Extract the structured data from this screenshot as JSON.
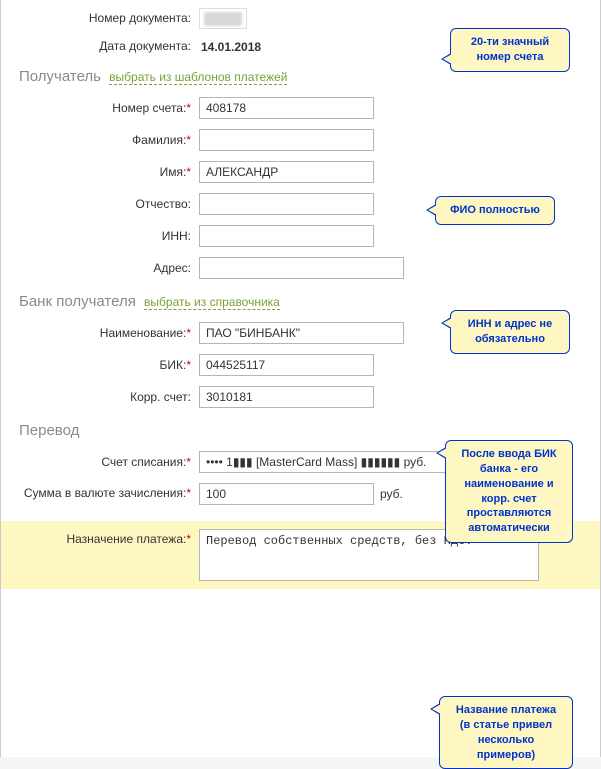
{
  "doc_no_label": "Номер документа:",
  "doc_no_value": "",
  "doc_date_label": "Дата документа:",
  "doc_date_value": "14.01.2018",
  "recipient": {
    "section": "Получатель",
    "templates_link": "выбрать из шаблонов платежей",
    "account_label": "Номер счета:",
    "account_value": "408178",
    "surname_label": "Фамилия:",
    "surname_value": "",
    "name_label": "Имя:",
    "name_value": "АЛЕКСАНДР",
    "patronymic_label": "Отчество:",
    "patronymic_value": "",
    "inn_label": "ИНН:",
    "inn_value": "",
    "address_label": "Адрес:",
    "address_value": ""
  },
  "bank": {
    "section": "Банк получателя",
    "dir_link": "выбрать из справочника",
    "name_label": "Наименование:",
    "name_value": "ПАО \"БИНБАНК\"",
    "bik_label": "БИК:",
    "bik_value": "044525117",
    "corr_label": "Корр. счет:",
    "corr_value": "3010181"
  },
  "transfer": {
    "section": "Перевод",
    "writeoff_label": "Счет списания:",
    "writeoff_value": "•••• 1▮▮▮ [MasterCard Mass]  ▮▮▮▮▮▮ руб.",
    "amount_label": "Сумма в валюте зачисления:",
    "amount_value": "100",
    "amount_unit": "руб.",
    "purpose_label": "Назначение платежа:",
    "purpose_value": "Перевод собственных средств, без НДС."
  },
  "callouts": {
    "c1": "20-ти значный номер счета",
    "c2": "ФИО полностью",
    "c3": "ИНН и адрес не обязательно",
    "c4": "После ввода БИК банка - его наименование и корр. счет проставляются автоматически",
    "c5": "Название платежа (в статье привел несколько примеров)"
  },
  "asterisk": "*"
}
